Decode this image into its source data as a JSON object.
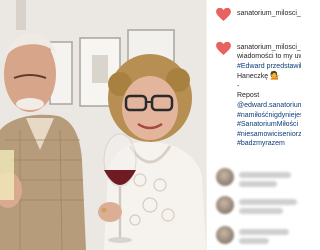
{
  "post": {
    "image_alt_icon": "photo-of-couple",
    "colors": {
      "heart": "#e8625f",
      "username": "#262626",
      "hashtag": "#0d3d7a"
    }
  },
  "comments": [
    {
      "username": "sanatorium_milosci_tvp"
    },
    {
      "username": "sanatorium_milosci_tvp",
      "lines": [
        {
          "text": "wiadomości to my uwie",
          "type": "text"
        },
        {
          "text": "#Edward przedstawił sw",
          "type": "tag"
        },
        {
          "text": "Haneczkę",
          "type": "text",
          "emoji": "💁"
        },
        {
          "text": "-",
          "type": "text"
        },
        {
          "text": "Repost",
          "type": "text"
        },
        {
          "text": "@edward.sanatorium_m",
          "type": "tag"
        },
        {
          "text": "#namiłośćnigdyniejest",
          "type": "tag"
        },
        {
          "text": "#SanatoriumMiłości",
          "type": "tag"
        },
        {
          "text": "#niesamowiciseniorzy",
          "type": "tag"
        },
        {
          "text": "#badzmyrazem",
          "type": "tag"
        }
      ]
    }
  ]
}
